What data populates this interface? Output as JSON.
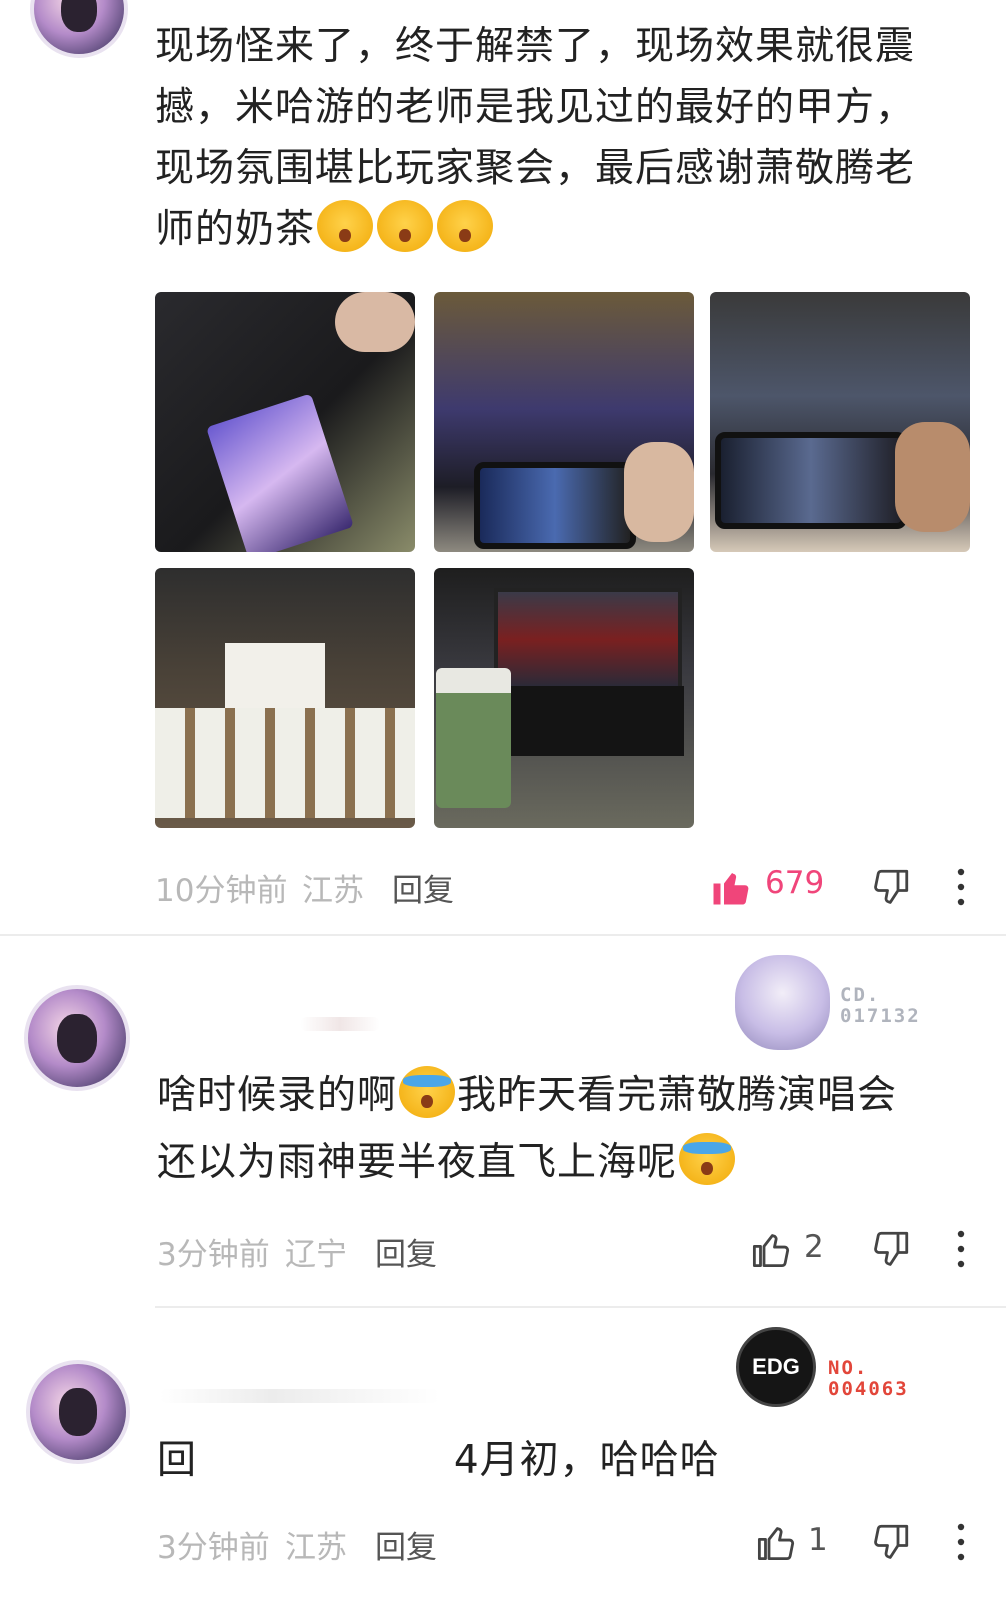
{
  "comments": [
    {
      "text_lines": [
        "现场怪来了，终于解禁了，现场效果就很震",
        "撼，米哈游的老师是我见过的最好的甲方，",
        "现场氛围堪比玩家聚会，最后感谢萧敬腾老",
        "师的奶茶"
      ],
      "time": "10分钟前",
      "location": "江苏",
      "reply_label": "回复",
      "like_count": "679",
      "liked": true
    },
    {
      "text_line1_a": "啥时候录的啊",
      "text_line1_b": "我昨天看完萧敬腾演唱会",
      "text_line2": "还以为雨神要半夜直飞上海呢",
      "badge_line1": "CD.",
      "badge_line2": "017132",
      "time": "3分钟前",
      "location": "辽宁",
      "reply_label": "回复",
      "like_count": "2",
      "liked": false
    },
    {
      "text_prefix": "回",
      "text_body": "4月初，哈哈哈",
      "badge_logo": "EDG",
      "badge_line1": "NO.",
      "badge_line2": "004063",
      "time": "3分钟前",
      "location": "江苏",
      "reply_label": "回复",
      "like_count": "1",
      "liked": false
    }
  ],
  "colors": {
    "like_active": "#f0457a",
    "badge_red": "#e2463a",
    "badge_grey": "#b0b4bd"
  }
}
